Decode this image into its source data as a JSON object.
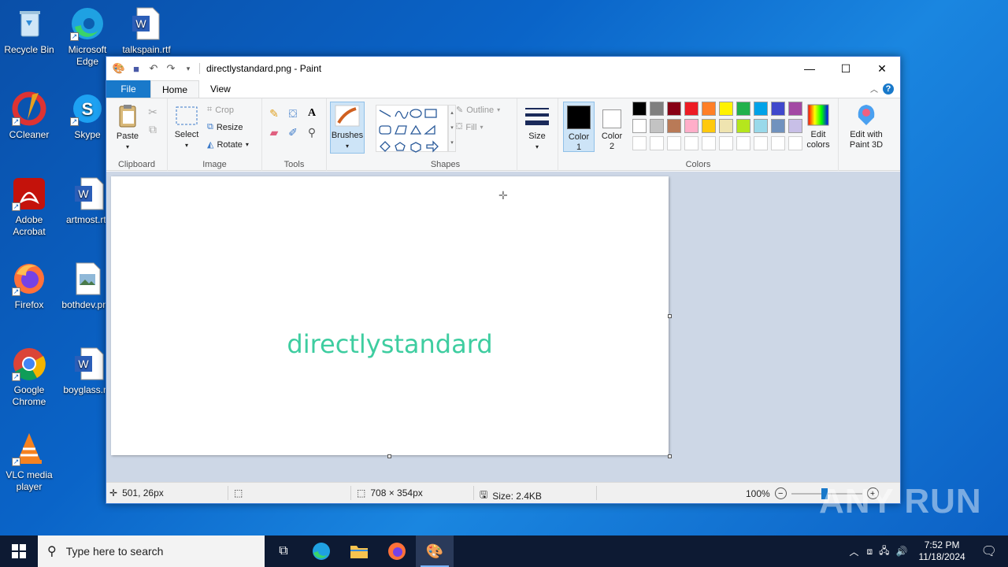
{
  "desktop": {
    "icons": [
      {
        "label": "Recycle Bin"
      },
      {
        "label": "Microsoft Edge"
      },
      {
        "label": "talkspain.rtf"
      },
      {
        "label": "CCleaner"
      },
      {
        "label": "Skype"
      },
      {
        "label": "Adobe Acrobat"
      },
      {
        "label": "artmost.rtf"
      },
      {
        "label": "Firefox"
      },
      {
        "label": "bothdev.png"
      },
      {
        "label": "Google Chrome"
      },
      {
        "label": "boyglass.rtf"
      },
      {
        "label": "VLC media player"
      }
    ]
  },
  "window": {
    "title": "directlystandard.png - Paint",
    "tabs": {
      "file": "File",
      "home": "Home",
      "view": "View"
    },
    "help": "?"
  },
  "ribbon": {
    "clipboard": {
      "label": "Clipboard",
      "paste": "Paste"
    },
    "image": {
      "label": "Image",
      "select": "Select",
      "crop": "Crop",
      "resize": "Resize",
      "rotate": "Rotate"
    },
    "tools": {
      "label": "Tools"
    },
    "brushes": {
      "label": "Brushes"
    },
    "shapes": {
      "label": "Shapes",
      "outline": "Outline",
      "fill": "Fill"
    },
    "size": {
      "label": "Size"
    },
    "colors": {
      "label": "Colors",
      "color1": "Color 1",
      "color2": "Color 2",
      "edit_colors": "Edit colors",
      "edit_paint3d": "Edit with Paint 3D",
      "color1_value": "#000000",
      "color2_value": "#ffffff",
      "palette_row1": [
        "#000000",
        "#7f7f7f",
        "#880015",
        "#ed1c24",
        "#ff7f27",
        "#fff200",
        "#22b14c",
        "#00a2e8",
        "#3f48cc",
        "#a349a4"
      ],
      "palette_row2": [
        "#ffffff",
        "#c3c3c3",
        "#b97a57",
        "#ffaec9",
        "#ffc90e",
        "#efe4b0",
        "#b5e61d",
        "#99d9ea",
        "#7092be",
        "#c8bfe7"
      ]
    }
  },
  "canvas": {
    "text": "directlystandard",
    "text_color": "#3ecda0"
  },
  "status": {
    "cursor": "501, 26px",
    "dimensions": "708 × 354px",
    "size": "Size: 2.4KB",
    "zoom": "100%"
  },
  "taskbar": {
    "search_placeholder": "Type here to search",
    "time": "7:52 PM",
    "date": "11/18/2024"
  },
  "watermark": "ANY RUN"
}
